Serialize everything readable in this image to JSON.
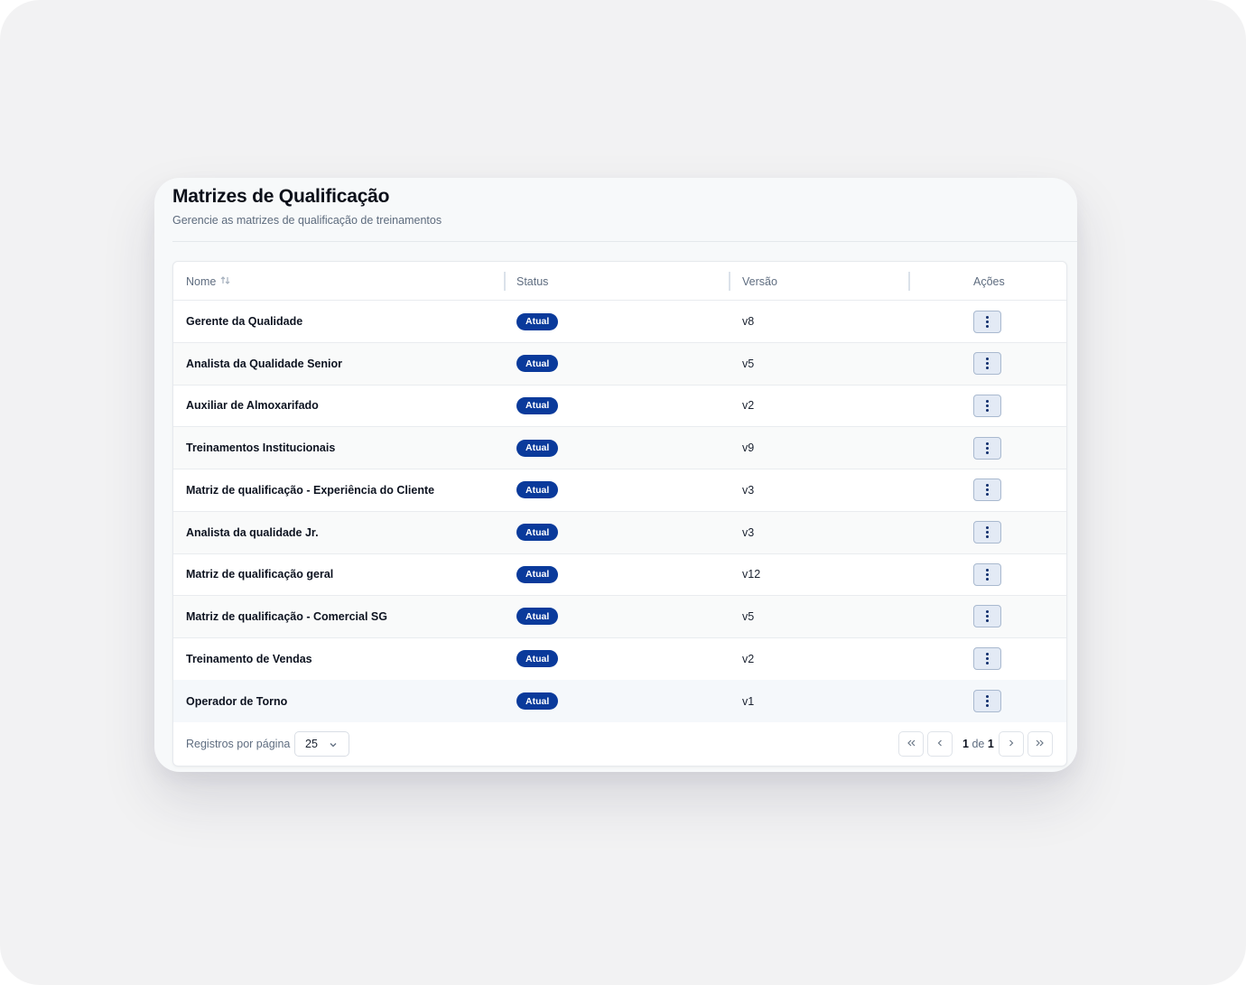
{
  "header": {
    "title": "Matrizes de Qualificação",
    "subtitle": "Gerencie as matrizes de qualificação de treinamentos"
  },
  "table": {
    "columns": {
      "name": "Nome",
      "status": "Status",
      "version": "Versão",
      "actions": "Ações"
    },
    "rows": [
      {
        "name": "Gerente da Qualidade",
        "status": "Atual",
        "version": "v8"
      },
      {
        "name": "Analista da Qualidade Senior",
        "status": "Atual",
        "version": "v5"
      },
      {
        "name": "Auxiliar de Almoxarifado",
        "status": "Atual",
        "version": "v2"
      },
      {
        "name": "Treinamentos Institucionais",
        "status": "Atual",
        "version": "v9"
      },
      {
        "name": "Matriz de qualificação - Experiência do Cliente",
        "status": "Atual",
        "version": "v3"
      },
      {
        "name": "Analista da qualidade Jr.",
        "status": "Atual",
        "version": "v3"
      },
      {
        "name": "Matriz de qualificação geral",
        "status": "Atual",
        "version": "v12"
      },
      {
        "name": "Matriz de qualificação - Comercial SG",
        "status": "Atual",
        "version": "v5"
      },
      {
        "name": "Treinamento de Vendas",
        "status": "Atual",
        "version": "v2"
      },
      {
        "name": "Operador de Torno",
        "status": "Atual",
        "version": "v1"
      }
    ]
  },
  "pagination": {
    "rows_per_page_label": "Registros por página",
    "rows_per_page_value": "25",
    "current_page": "1",
    "of_label": "de",
    "total_pages": "1"
  },
  "icons": {
    "sort": "sort-arrows-icon",
    "actions": "kebab-menu-icon",
    "select": "chevron-down-icon",
    "first": "chevrons-left-icon",
    "prev": "chevron-left-icon",
    "next": "chevron-right-icon",
    "last": "chevrons-right-icon"
  },
  "colors": {
    "badge": "#0a3a9b",
    "action_button_bg": "#e3eaf5",
    "title": "#0b0f19"
  }
}
